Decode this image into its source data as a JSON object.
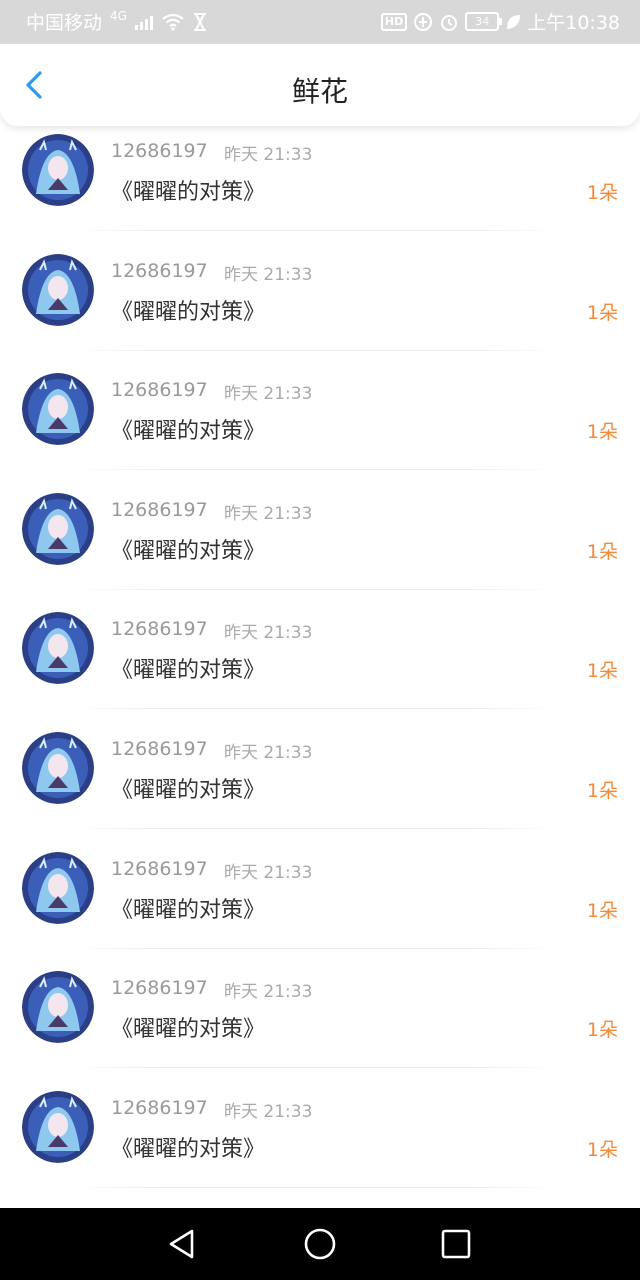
{
  "status_bar": {
    "carrier": "中国移动",
    "network": "4G",
    "time": "上午10:38",
    "battery_level": "34"
  },
  "header": {
    "title": "鲜花"
  },
  "items": [
    {
      "user": "12686197",
      "time": "昨天 21:33",
      "book": "《曜曜的对策》",
      "count": "1朵"
    },
    {
      "user": "12686197",
      "time": "昨天 21:33",
      "book": "《曜曜的对策》",
      "count": "1朵"
    },
    {
      "user": "12686197",
      "time": "昨天 21:33",
      "book": "《曜曜的对策》",
      "count": "1朵"
    },
    {
      "user": "12686197",
      "time": "昨天 21:33",
      "book": "《曜曜的对策》",
      "count": "1朵"
    },
    {
      "user": "12686197",
      "time": "昨天 21:33",
      "book": "《曜曜的对策》",
      "count": "1朵"
    },
    {
      "user": "12686197",
      "time": "昨天 21:33",
      "book": "《曜曜的对策》",
      "count": "1朵"
    },
    {
      "user": "12686197",
      "time": "昨天 21:33",
      "book": "《曜曜的对策》",
      "count": "1朵"
    },
    {
      "user": "12686197",
      "time": "昨天 21:33",
      "book": "《曜曜的对策》",
      "count": "1朵"
    },
    {
      "user": "12686197",
      "time": "昨天 21:33",
      "book": "《曜曜的对策》",
      "count": "1朵"
    }
  ],
  "colors": {
    "accent": "#2d9cf0",
    "count": "#f28a3a",
    "status_bar": "#d8d8d8"
  },
  "icons": {
    "back": "chevron-left-icon",
    "nav_back": "triangle-back-icon",
    "nav_home": "circle-home-icon",
    "nav_recents": "square-recents-icon"
  }
}
